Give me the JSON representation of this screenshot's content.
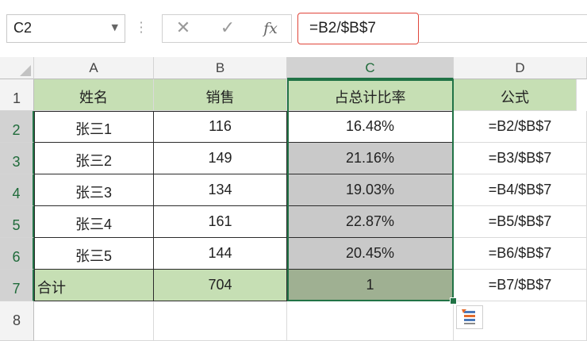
{
  "formula_bar": {
    "name_box": "C2",
    "formula": "=B2/$B$7",
    "cancel_glyph": "✕",
    "enter_glyph": "✓",
    "fx_label": "fx"
  },
  "columns": [
    "A",
    "B",
    "C",
    "D"
  ],
  "rows": [
    "1",
    "2",
    "3",
    "4",
    "5",
    "6",
    "7",
    "8"
  ],
  "headers": [
    "姓名",
    "销售",
    "占总计比率",
    "公式"
  ],
  "data": [
    {
      "name": "张三1",
      "sales": "116",
      "ratio": "16.48%",
      "formula": "=B2/$B$7"
    },
    {
      "name": "张三2",
      "sales": "149",
      "ratio": "21.16%",
      "formula": "=B3/$B$7"
    },
    {
      "name": "张三3",
      "sales": "134",
      "ratio": "19.03%",
      "formula": "=B4/$B$7"
    },
    {
      "name": "张三4",
      "sales": "161",
      "ratio": "22.87%",
      "formula": "=B5/$B$7"
    },
    {
      "name": "张三5",
      "sales": "144",
      "ratio": "20.45%",
      "formula": "=B6/$B$7"
    }
  ],
  "total": {
    "name": "合计",
    "sales": "704",
    "ratio": "1",
    "formula": "=B7/$B$7"
  },
  "colors": {
    "accent": "#217346",
    "header_fill": "#c6dfb4",
    "selection_fill": "#c9c9c9",
    "total_fill": "#9fb092",
    "highlight_border": "#e0453a"
  }
}
